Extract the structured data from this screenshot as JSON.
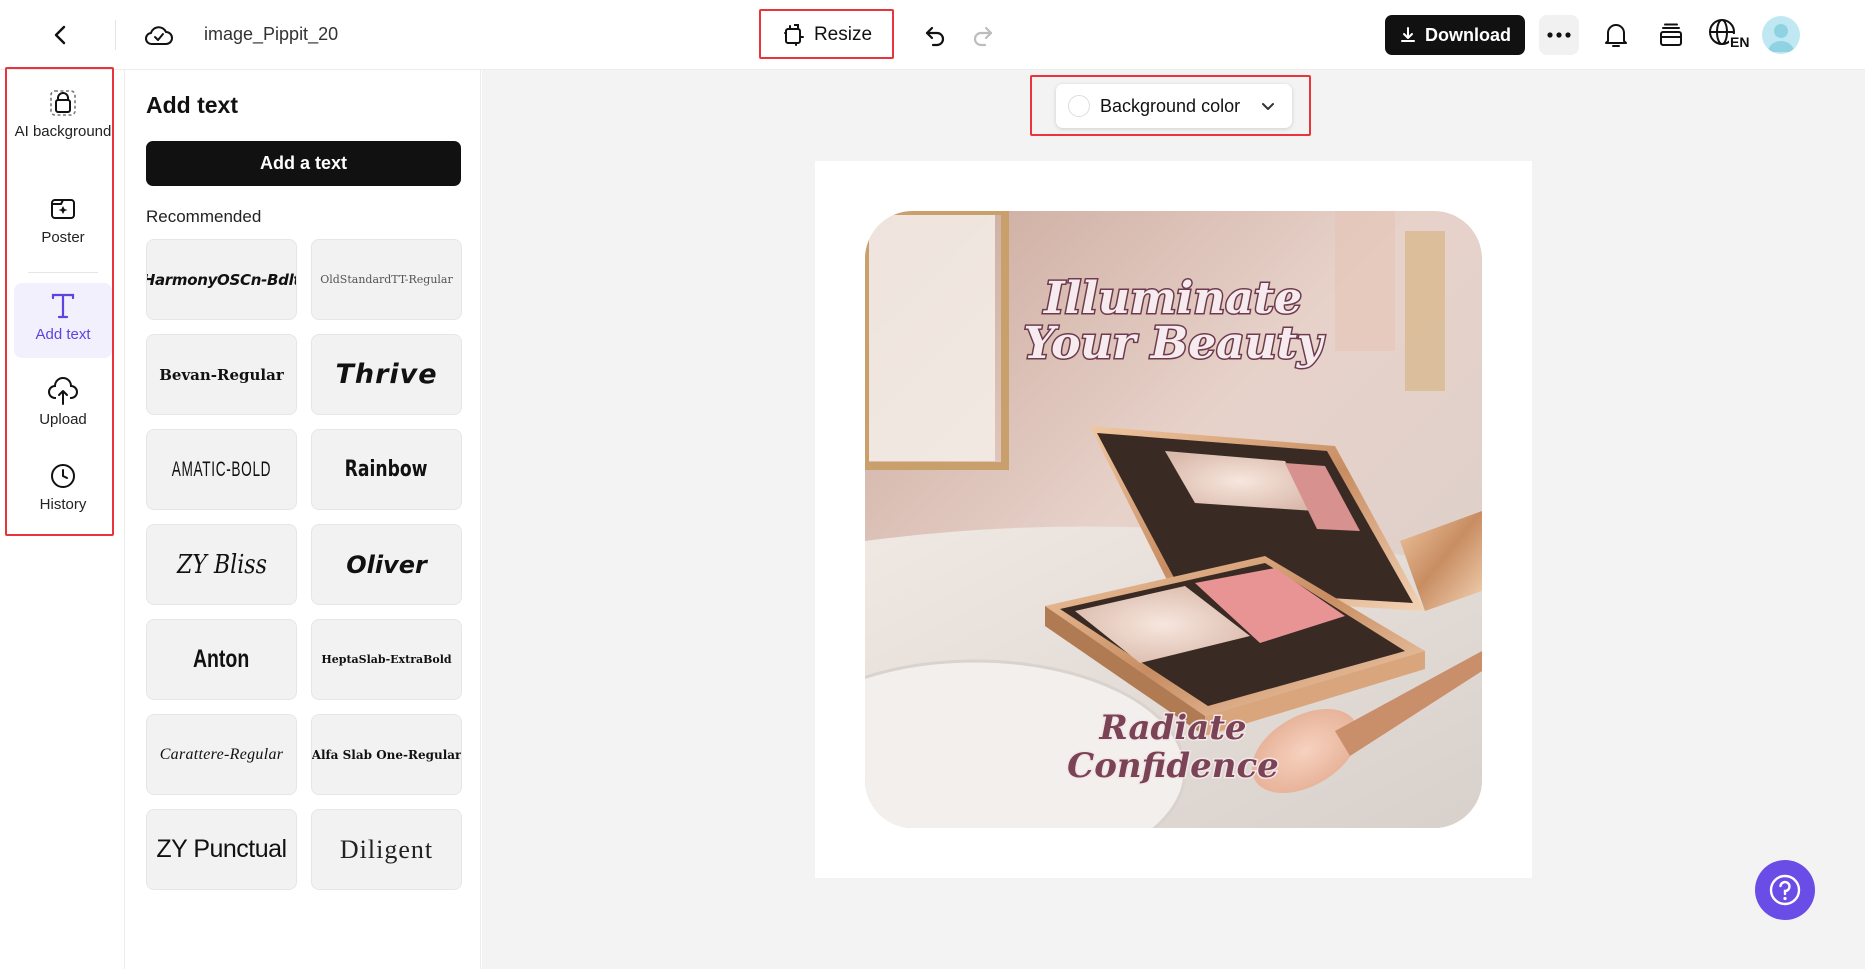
{
  "header": {
    "file_name": "image_Pippit_20",
    "resize_label": "Resize",
    "download_label": "Download",
    "language_code": "EN"
  },
  "left_rail": {
    "items": [
      {
        "label": "AI background",
        "icon": "ai-background-icon"
      },
      {
        "label": "Poster",
        "icon": "poster-icon"
      },
      {
        "label": "Add text",
        "icon": "text-icon",
        "active": true
      },
      {
        "label": "Upload",
        "icon": "upload-icon"
      },
      {
        "label": "History",
        "icon": "history-icon"
      }
    ]
  },
  "panel": {
    "title": "Add text",
    "add_button": "Add a text",
    "recommended_label": "Recommended",
    "fonts": [
      "HarmonyOSCn-Bdlt",
      "OldStandardTT-Regular",
      "Bevan-Regular",
      "Thrive",
      "AMATIC-BOLD",
      "Rainbow",
      "ZY Bliss",
      "Oliver",
      "Anton",
      "HeptaSlab-ExtraBold",
      "Carattere-Regular",
      "Alfa Slab One-Regular",
      "ZY Punctual",
      "Diligent"
    ]
  },
  "workspace": {
    "background_color_label": "Background color"
  },
  "canvas": {
    "headline_line1": "Illuminate",
    "headline_line2": "Your Beauty",
    "tagline_line1": "Radiate",
    "tagline_line2": "Confidence"
  },
  "colors": {
    "accent_purple": "#5b45e0",
    "highlight_red": "#e8343a",
    "headline_fill": "#f6ecef",
    "headline_stroke": "#6e3a4c"
  }
}
